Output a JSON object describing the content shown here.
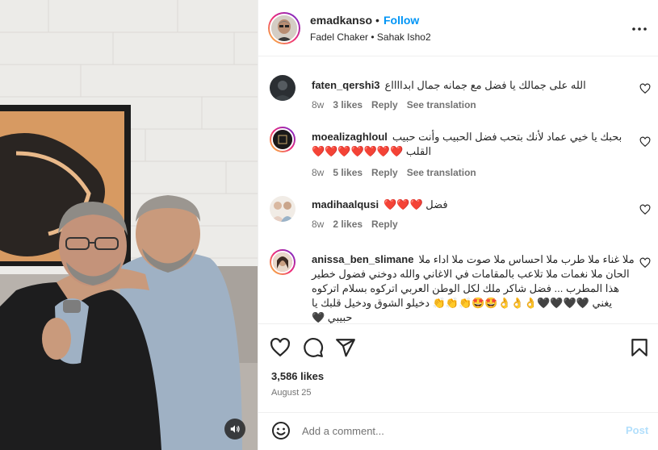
{
  "post": {
    "username": "emadkanso",
    "follow_label": "Follow",
    "separator": "•",
    "audio_line": "Fadel Chaker • Sahak Isho2"
  },
  "comments": [
    {
      "username": "faten_qershi3",
      "text": "الله على جمالك يا فضل مع جمانه جمال ابدااااع",
      "age": "8w",
      "likes": "3 likes",
      "reply": "Reply",
      "translate": "See translation"
    },
    {
      "username": "moealizaghloul",
      "text": "بحبك يا خيي عماد لأنك بتحب فضل الحبيب وأنت حبيب القلب ❤️❤️❤️❤️❤️❤️❤️",
      "age": "8w",
      "likes": "5 likes",
      "reply": "Reply",
      "translate": "See translation"
    },
    {
      "username": "madihaalqusi",
      "text": "فضل ❤️❤️❤️",
      "age": "8w",
      "likes": "2 likes",
      "reply": "Reply",
      "translate": ""
    },
    {
      "username": "anissa_ben_slimane",
      "text": "ملا غناء ملا طرب ملا احساس ملا صوت ملا اداء ملا الحان ملا نغمات ملا تلاعب بالمقامات في الاغاني والله دوخني فضول خطير هذا المطرب ... فضل شاكر ملك لكل الوطن العربي اتركوه بسلام اتركوه يغني 🖤🖤🖤🖤👌👌👌🤩🤩👏👏👏 دخيلو الشوق ودخيل قلبك يا حبيبي 🖤",
      "age": "",
      "likes": "",
      "reply": "",
      "translate": ""
    }
  ],
  "likes_count": "3,586 likes",
  "date": "August 25",
  "add_comment": {
    "placeholder": "Add a comment...",
    "post_label": "Post"
  },
  "icons": {
    "like": "heart-icon",
    "comment": "comment-icon",
    "share": "share-icon",
    "save": "bookmark-icon",
    "more": "more-icon",
    "emoji": "emoji-icon",
    "sound": "speaker-icon"
  },
  "colors": {
    "accent": "#0095f6",
    "muted": "#737373",
    "post_disabled": "#b2dffc",
    "heart_red": "#ed4956"
  }
}
